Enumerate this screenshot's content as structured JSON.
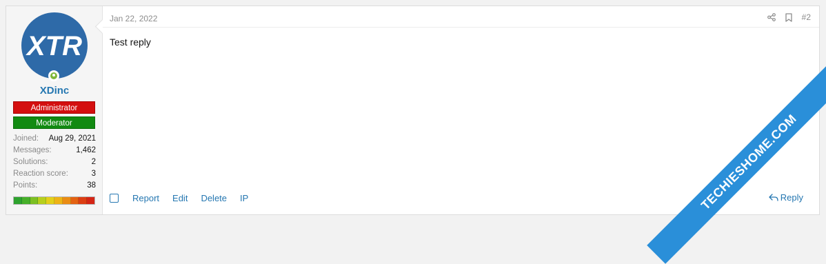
{
  "user": {
    "username": "XDinc",
    "avatar_text": "XTR",
    "banners": {
      "admin": "Administrator",
      "moderator": "Moderator"
    },
    "stats": [
      {
        "label": "Joined:",
        "value": "Aug 29, 2021"
      },
      {
        "label": "Messages:",
        "value": "1,462"
      },
      {
        "label": "Solutions:",
        "value": "2"
      },
      {
        "label": "Reaction score:",
        "value": "3"
      },
      {
        "label": "Points:",
        "value": "38"
      }
    ]
  },
  "post": {
    "date": "Jan 22, 2022",
    "number": "#2",
    "body": "Test reply",
    "actions": {
      "report": "Report",
      "edit": "Edit",
      "delete": "Delete",
      "ip": "IP"
    },
    "reply": "Reply"
  },
  "icons": {
    "share": "share-icon",
    "bookmark": "bookmark-icon",
    "reply": "reply-icon",
    "online": "online-status-icon"
  },
  "watermark": "TECHIESHOME.COM",
  "colors": {
    "link": "#2577b1",
    "admin": "#d40f0f",
    "moderator": "#128a12",
    "ribbon": "#2a8fd9",
    "avatar": "#2e6aa8"
  }
}
